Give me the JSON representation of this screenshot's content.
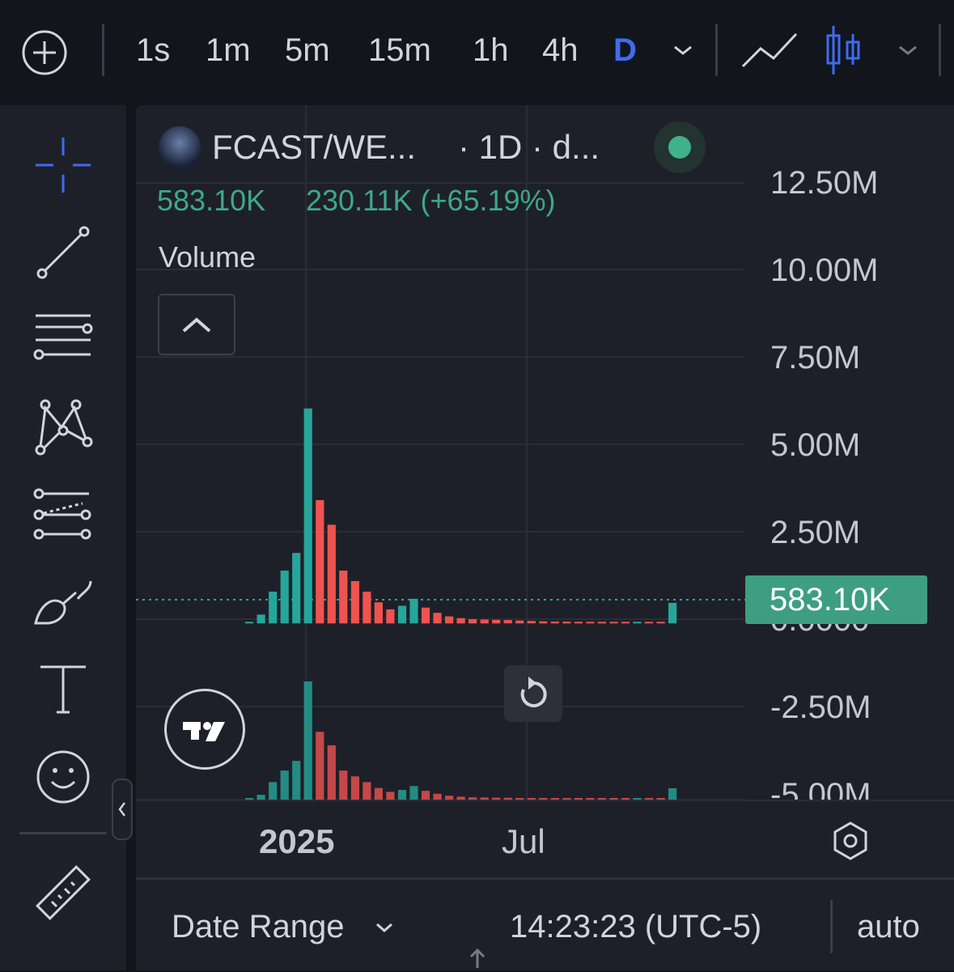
{
  "toolbar": {
    "intervals": [
      "1s",
      "1m",
      "5m",
      "15m",
      "1h",
      "4h",
      "D"
    ],
    "selected_interval": "D"
  },
  "legend": {
    "symbol": "FCAST/WE...",
    "interval_source": "· 1D · d...",
    "last_value": "583.10K",
    "change": "230.11K (+65.19%)",
    "indicator_name": "Volume"
  },
  "price_axis": {
    "ticks": [
      "12.50M",
      "10.00M",
      "7.50M",
      "5.00M",
      "2.50M",
      "0.0000",
      "-2.50M",
      "-5.00M"
    ],
    "last_price_label": "583.10K"
  },
  "time_axis": {
    "labels": [
      "2025",
      "Jul"
    ]
  },
  "bottom_bar": {
    "date_range_label": "Date Range",
    "clock": "14:23:23 (UTC-5)",
    "scale_mode": "auto"
  },
  "colors": {
    "up": "#26a69a",
    "down": "#ef5350",
    "accent": "#3d6cf0",
    "last_price_bg": "#3e9e80"
  },
  "chart_data": {
    "type": "bar",
    "title": "",
    "ylim": [
      -5000000,
      12500000
    ],
    "x_labels": [
      "2025",
      "Jul"
    ],
    "last_value": 583100,
    "change": 230110,
    "change_pct": 65.19,
    "series": [
      {
        "values": [
          20000,
          250000,
          900000,
          1500000,
          2000000,
          6100000,
          3500000,
          2800000,
          1500000,
          1200000,
          900000,
          600000,
          400000,
          500000,
          700000,
          450000,
          300000,
          200000,
          150000,
          120000,
          110000,
          100000,
          95000,
          80000,
          70000,
          60000,
          55000,
          50000,
          48000,
          45000,
          40000,
          35000,
          30000,
          30000,
          28000,
          25000,
          583100
        ]
      }
    ]
  }
}
